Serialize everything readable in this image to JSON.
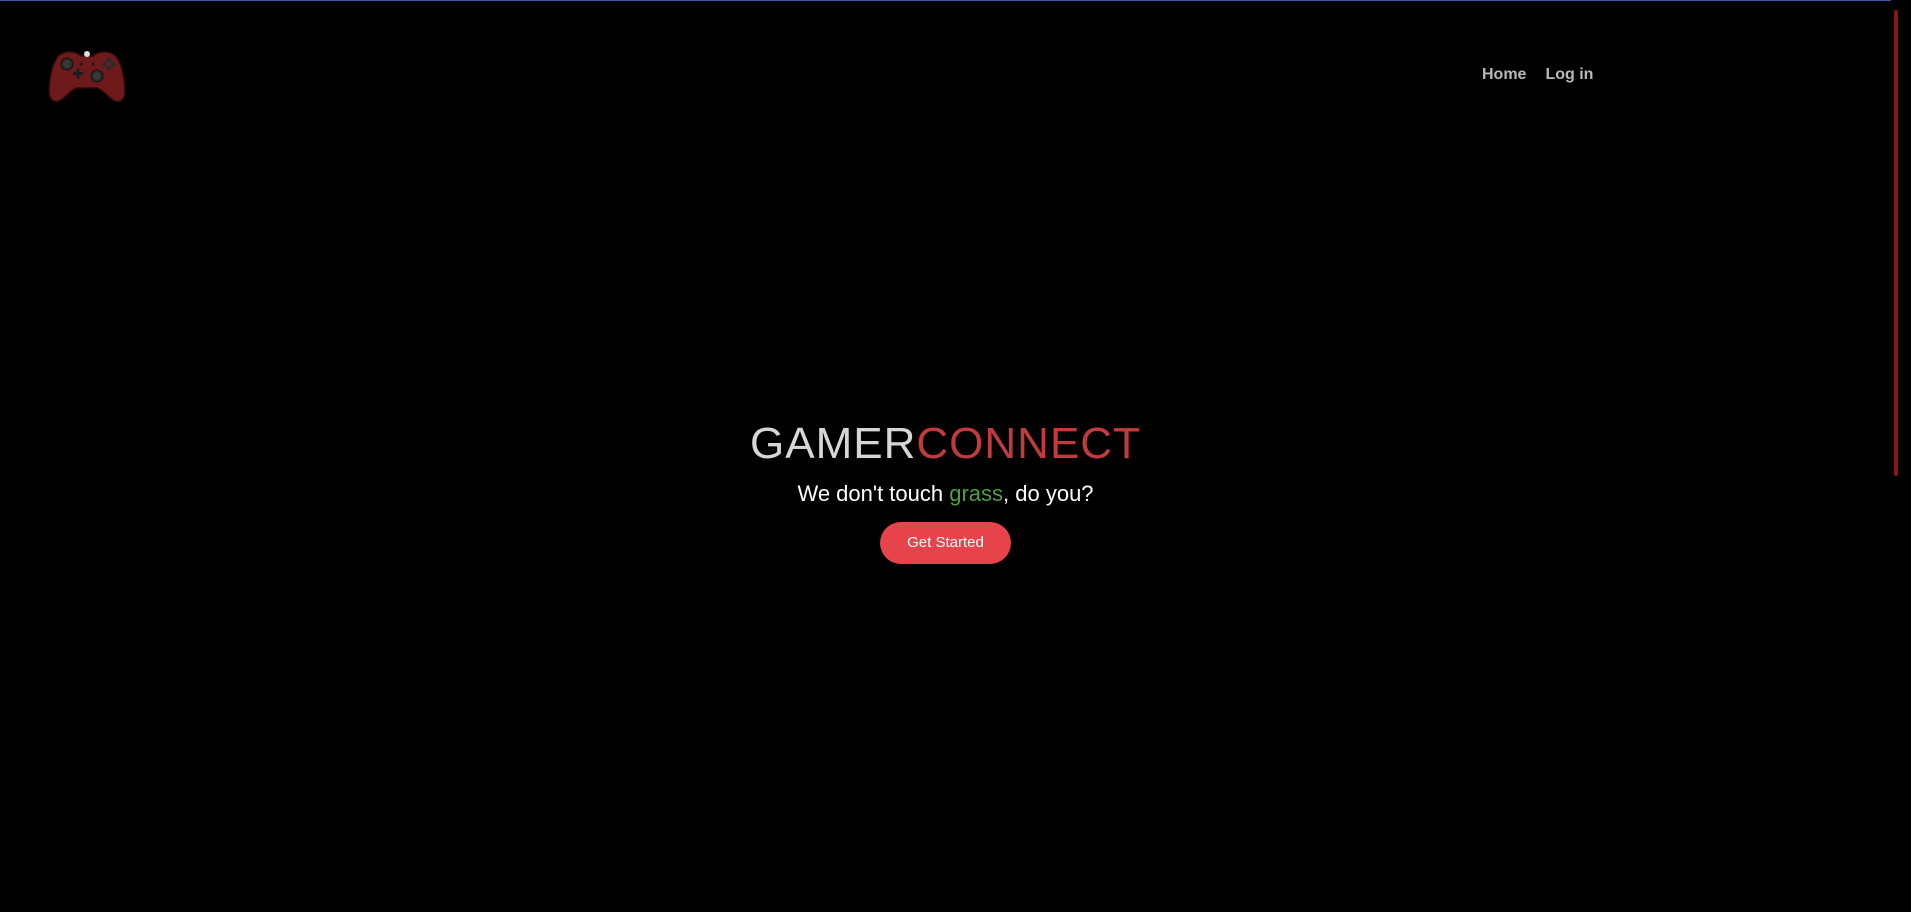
{
  "brand": {
    "logo_icon": "gamepad-icon",
    "logo_color": "#7a1c1c"
  },
  "nav": {
    "items": [
      {
        "label": "Home"
      },
      {
        "label": "Log in"
      }
    ]
  },
  "hero": {
    "title_part1": "GAMER",
    "title_part2": "CONNECT",
    "title_part1_color": "#d6d6d6",
    "title_part2_color": "#c13a3e",
    "tagline_before": "We don't touch ",
    "tagline_highlight": "grass",
    "tagline_after": ", do you?",
    "highlight_color": "#4aa23e",
    "cta_label": "Get Started",
    "cta_color": "#e6434a"
  },
  "colors": {
    "background": "#000000",
    "nav_text": "#b9b9b9",
    "scrollbar_thumb": "#8e1414"
  }
}
